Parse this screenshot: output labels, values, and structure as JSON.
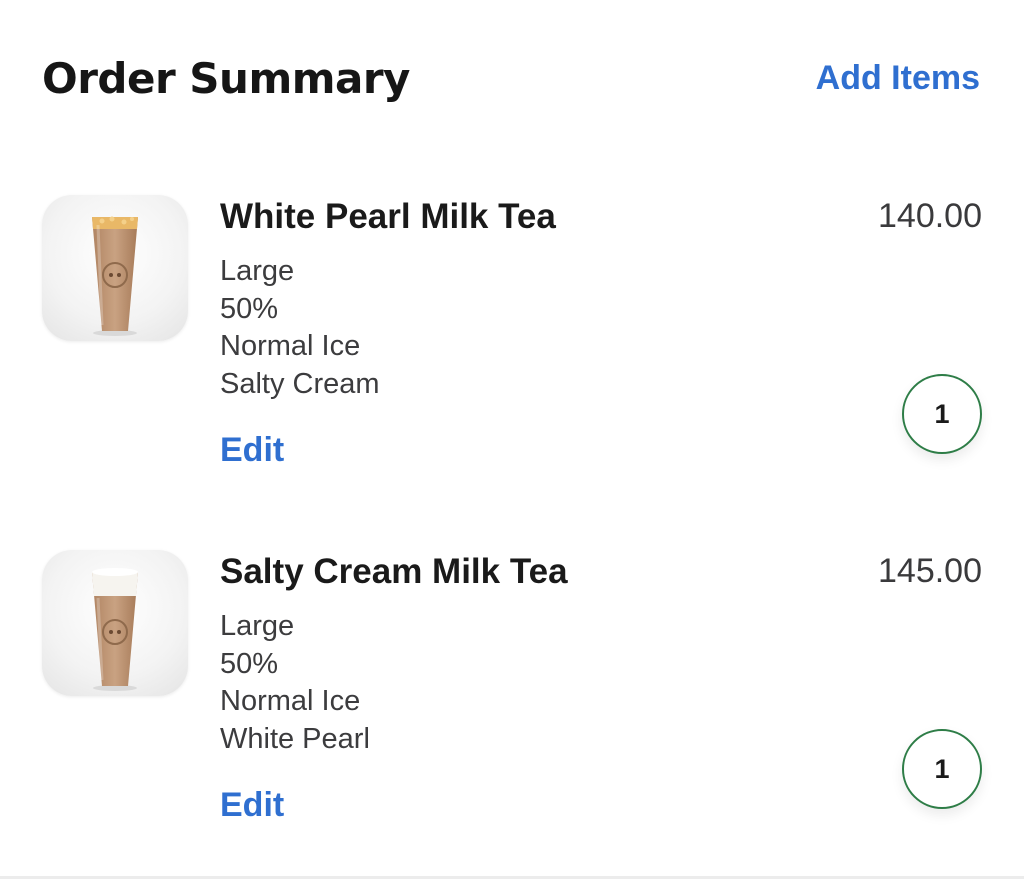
{
  "header": {
    "title": "Order Summary",
    "add_items_label": "Add Items"
  },
  "colors": {
    "accent": "#2f6fd0",
    "quantity_border": "#2e7d47"
  },
  "items": [
    {
      "name": "White Pearl Milk Tea",
      "price": "140.00",
      "options": [
        "Large",
        "50%",
        "Normal Ice",
        "Salty Cream"
      ],
      "edit_label": "Edit",
      "quantity": "1",
      "image_icon": "milk-tea-cup-icon"
    },
    {
      "name": "Salty Cream Milk Tea",
      "price": "145.00",
      "options": [
        "Large",
        "50%",
        "Normal Ice",
        "White Pearl"
      ],
      "edit_label": "Edit",
      "quantity": "1",
      "image_icon": "milk-tea-cup-icon"
    }
  ]
}
